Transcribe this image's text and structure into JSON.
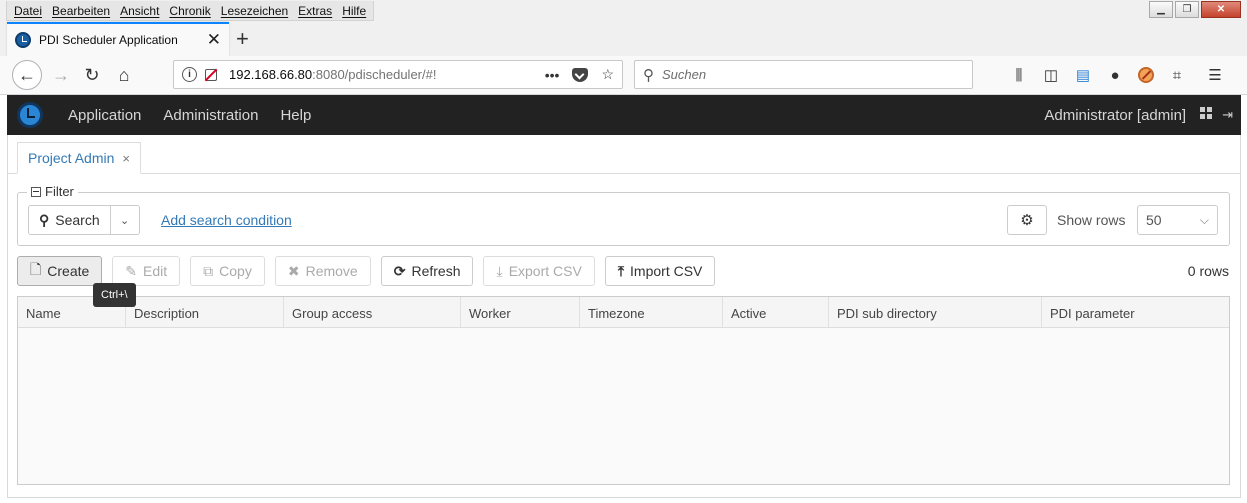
{
  "browser": {
    "menu": [
      "Datei",
      "Bearbeiten",
      "Ansicht",
      "Chronik",
      "Lesezeichen",
      "Extras",
      "Hilfe"
    ],
    "tab_title": "PDI Scheduler Application",
    "url_host": "192.168.66.80",
    "url_rest": ":8080/pdischeduler/#!",
    "search_placeholder": "Suchen"
  },
  "app": {
    "nav": [
      "Application",
      "Administration",
      "Help"
    ],
    "user": "Administrator [admin]"
  },
  "page": {
    "tab_label": "Project Admin",
    "filter_label": "Filter",
    "search_label": "Search",
    "add_condition": "Add search condition",
    "show_rows_label": "Show rows",
    "rows_value": "50",
    "buttons": {
      "create": "Create",
      "edit": "Edit",
      "copy": "Copy",
      "remove": "Remove",
      "refresh": "Refresh",
      "export": "Export CSV",
      "import": "Import CSV"
    },
    "tooltip": "Ctrl+\\",
    "row_count": "0 rows",
    "columns": [
      "Name",
      "Description",
      "Group access",
      "Worker",
      "Timezone",
      "Active",
      "PDI sub directory",
      "PDI parameter"
    ]
  }
}
